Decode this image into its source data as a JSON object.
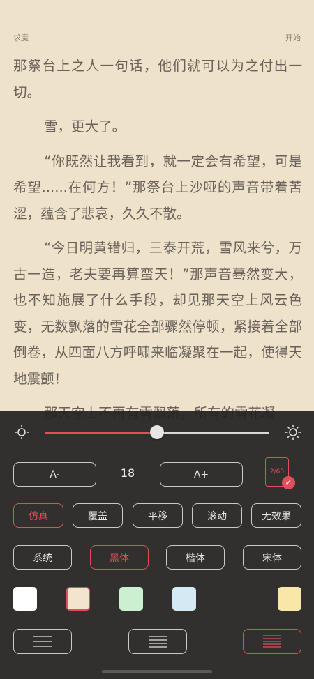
{
  "header": {
    "book_title": "求魔",
    "chapter_status": "开始"
  },
  "content": {
    "paragraphs": [
      "那祭台上之人一句话，他们就可以为之付出一切。",
      "雪，更大了。",
      "“你既然让我看到，就一定会有希望，可是希望......在何方！”那祭台上沙哑的声音带着苦涩，蕴含了悲哀，久久不散。",
      "“今日明黄错归，三泰开荒，雪风来兮，万古一造，老夫要再算蛮天！”那声音蓦然变大，也不知施展了什么手段，却见那天空上风云色变，无数飘落的雪花全部骤然停顿，紧接着全部倒卷，从四面八方呼啸来临凝聚在一起，使得天地震颤！",
      "那天空上不再有雪飘落，所有的雪花凝"
    ]
  },
  "settings": {
    "brightness": {
      "value": 0.5,
      "low_icon": "sun-dim-icon",
      "high_icon": "sun-bright-icon"
    },
    "font_size": {
      "decrease_label": "A-",
      "value": "18",
      "increase_label": "A+"
    },
    "page_badge": {
      "label": "2/60"
    },
    "page_modes": [
      {
        "label": "仿真",
        "active": true
      },
      {
        "label": "覆盖",
        "active": false
      },
      {
        "label": "平移",
        "active": false
      },
      {
        "label": "滚动",
        "active": false
      },
      {
        "label": "无效果",
        "active": false
      }
    ],
    "fonts": [
      {
        "label": "系统",
        "active": false
      },
      {
        "label": "黑体",
        "active": true
      },
      {
        "label": "楷体",
        "active": false
      },
      {
        "label": "宋体",
        "active": false
      }
    ],
    "backgrounds": [
      "#ffffff",
      "#f2e4cf",
      "#cdefd1",
      "#d5e9f4",
      "#f7e7a8"
    ],
    "active_background": 1,
    "spacing": [
      "wide",
      "medium",
      "narrow"
    ],
    "active_spacing": 2
  },
  "colors": {
    "accent": "#e0505b",
    "page_bg": "#efe2cb",
    "panel_bg": "#212121"
  }
}
